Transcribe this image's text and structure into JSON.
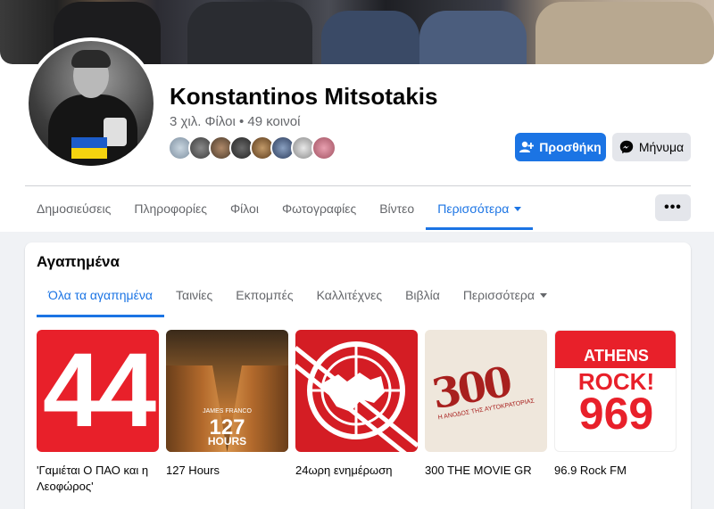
{
  "profile": {
    "name": "Konstantinos Mitsotakis",
    "friends_text": "3 χιλ. Φίλοι • 49 κοινοί"
  },
  "actions": {
    "add_label": "Προσθήκη",
    "message_label": "Μήνυμα",
    "more_label": "•••"
  },
  "tabs": [
    {
      "label": "Δημοσιεύσεις",
      "active": false
    },
    {
      "label": "Πληροφορίες",
      "active": false
    },
    {
      "label": "Φίλοι",
      "active": false
    },
    {
      "label": "Φωτογραφίες",
      "active": false
    },
    {
      "label": "Βίντεο",
      "active": false
    },
    {
      "label": "Περισσότερα",
      "active": true
    }
  ],
  "favorites": {
    "title": "Αγαπημένα",
    "subtabs": [
      {
        "label": "Όλα τα αγαπημένα",
        "active": true
      },
      {
        "label": "Ταινίες",
        "active": false
      },
      {
        "label": "Εκπομπές",
        "active": false
      },
      {
        "label": "Καλλιτέχνες",
        "active": false
      },
      {
        "label": "Βιβλία",
        "active": false
      },
      {
        "label": "Περισσότερα",
        "active": false
      }
    ],
    "items": [
      {
        "label": "'Γαμιέται Ο ΠΑΟ και η Λεοφώρος'",
        "thumb_text": "44"
      },
      {
        "label": "127 Hours",
        "thumb_text_a": "JAMES FRANCO",
        "thumb_text_b": "127",
        "thumb_text_c": "HOURS"
      },
      {
        "label": "24ωρη ενημέρωση"
      },
      {
        "label": "300 THE MOVIE GR",
        "thumb_text": "300",
        "thumb_sub": "Η ΑΝΟΔΟΣ ΤΗΣ ΑΥΤΟΚΡΑΤΟΡΙΑΣ"
      },
      {
        "label": "96.9 Rock FM",
        "thumb_l1": "ATHENS",
        "thumb_l2": "ROCK!",
        "thumb_l3": "969"
      }
    ]
  },
  "colors": {
    "accent": "#1b74e4",
    "text": "#050505",
    "secondary_text": "#65676b",
    "background": "#f0f2f5"
  }
}
